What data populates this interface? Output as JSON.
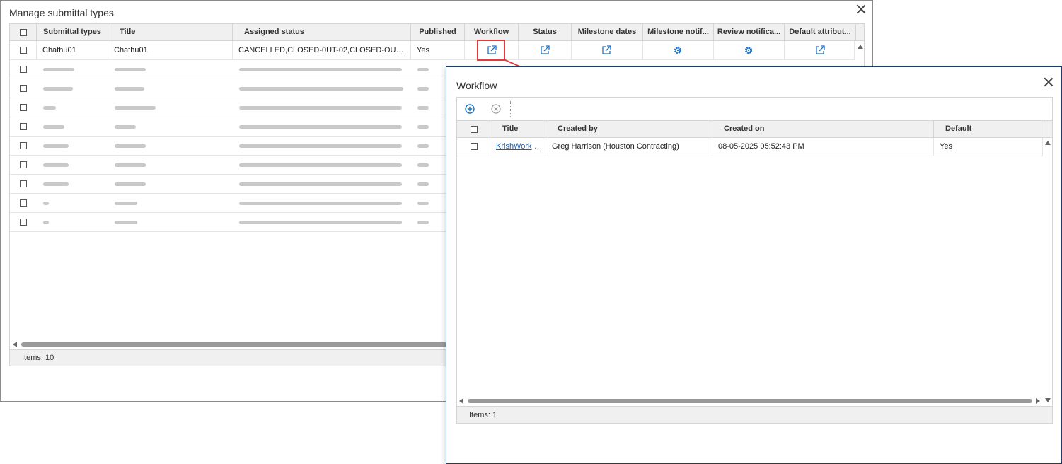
{
  "manage_dialog": {
    "title": "Manage submittal types",
    "columns": [
      "Submittal types",
      "Title",
      "Assigned status",
      "Published",
      "Workflow",
      "Status",
      "Milestone dates",
      "Milestone notif...",
      "Review notifica...",
      "Default attribut..."
    ],
    "first_row": {
      "submittal_type": "Chathu01",
      "title": "Chathu01",
      "assigned_status": "CANCELLED,CLOSED-0UT-02,CLOSED-OUT,DRAFT,O...",
      "published": "Yes"
    },
    "footer": "Items: 10",
    "colors": {
      "accent": "#1a73c9",
      "highlight": "#e23b3b"
    }
  },
  "workflow_dialog": {
    "title": "Workflow",
    "toolbar": {
      "add_icon": "add-circle-icon",
      "delete_icon": "remove-circle-icon"
    },
    "columns": [
      "Title",
      "Created by",
      "Created on",
      "Default"
    ],
    "rows": [
      {
        "title": "KrishWorkflo...",
        "created_by": "Greg Harrison (Houston Contracting)",
        "created_on": "08-05-2025 05:52:43 PM",
        "default": "Yes"
      }
    ],
    "footer": "Items: 1"
  }
}
